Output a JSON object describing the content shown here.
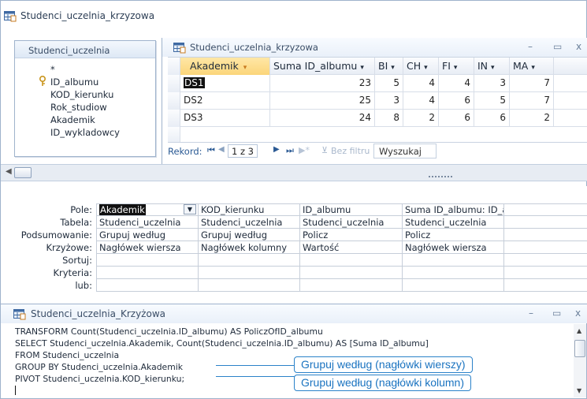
{
  "design_window": {
    "title": "Studenci_uczelnia_krzyzowa"
  },
  "table_box": {
    "title": "Studenci_uczelnia",
    "fields": [
      "*",
      "ID_albumu",
      "KOD_kierunku",
      "Rok_studiow",
      "Akademik",
      "ID_wykladowcy"
    ]
  },
  "result_window": {
    "title": "Studenci_uczelnia_krzyzowa",
    "columns": [
      "Akademik",
      "Suma ID_albumu",
      "BI",
      "CH",
      "FI",
      "IN",
      "MA"
    ],
    "rows": [
      [
        "DS1",
        "23",
        "5",
        "4",
        "4",
        "3",
        "7"
      ],
      [
        "DS2",
        "25",
        "3",
        "4",
        "6",
        "5",
        "7"
      ],
      [
        "DS3",
        "24",
        "8",
        "2",
        "6",
        "6",
        "2"
      ]
    ],
    "nav": {
      "record_label": "Rekord:",
      "position": "1 z 3",
      "filter": "Bez filtru",
      "search": "Wyszukaj"
    }
  },
  "qbe": {
    "row_labels": [
      "Pole:",
      "Tabela:",
      "Podsumowanie:",
      "Krzyżowe:",
      "Sortuj:",
      "Kryteria:",
      "lub:"
    ],
    "columns": [
      [
        "Akademik",
        "Studenci_uczelnia",
        "Grupuj według",
        "Nagłówek wiersza",
        "",
        "",
        ""
      ],
      [
        "KOD_kierunku",
        "Studenci_uczelnia",
        "Grupuj według",
        "Nagłówek kolumny",
        "",
        "",
        ""
      ],
      [
        "ID_albumu",
        "Studenci_uczelnia",
        "Policz",
        "Wartość",
        "",
        "",
        ""
      ],
      [
        "Suma ID_albumu: ID_a",
        "Studenci_uczelnia",
        "Policz",
        "Nagłówek wiersza",
        "",
        "",
        ""
      ]
    ]
  },
  "sql_window": {
    "title": "Studenci_uczelnia_Krzyżowa",
    "lines": [
      "TRANSFORM Count(Studenci_uczelnia.ID_albumu) AS PoliczOfID_albumu",
      "SELECT Studenci_uczelnia.Akademik, Count(Studenci_uczelnia.ID_albumu) AS [Suma ID_albumu]",
      "FROM Studenci_uczelnia",
      "GROUP BY Studenci_uczelnia.Akademik",
      "PIVOT Studenci_uczelnia.KOD_kierunku;"
    ]
  },
  "callouts": {
    "rows": "Grupuj według (nagłówki wierszy)",
    "cols": "Grupuj według (nagłówki kolumn)"
  },
  "window_buttons": {
    "minimize": "–",
    "maximize": "▭",
    "close": "x"
  },
  "colors": {
    "accent": "#2b82c9",
    "header_bg": "#dde8f5",
    "sort_arrow": "#e08a2b"
  }
}
